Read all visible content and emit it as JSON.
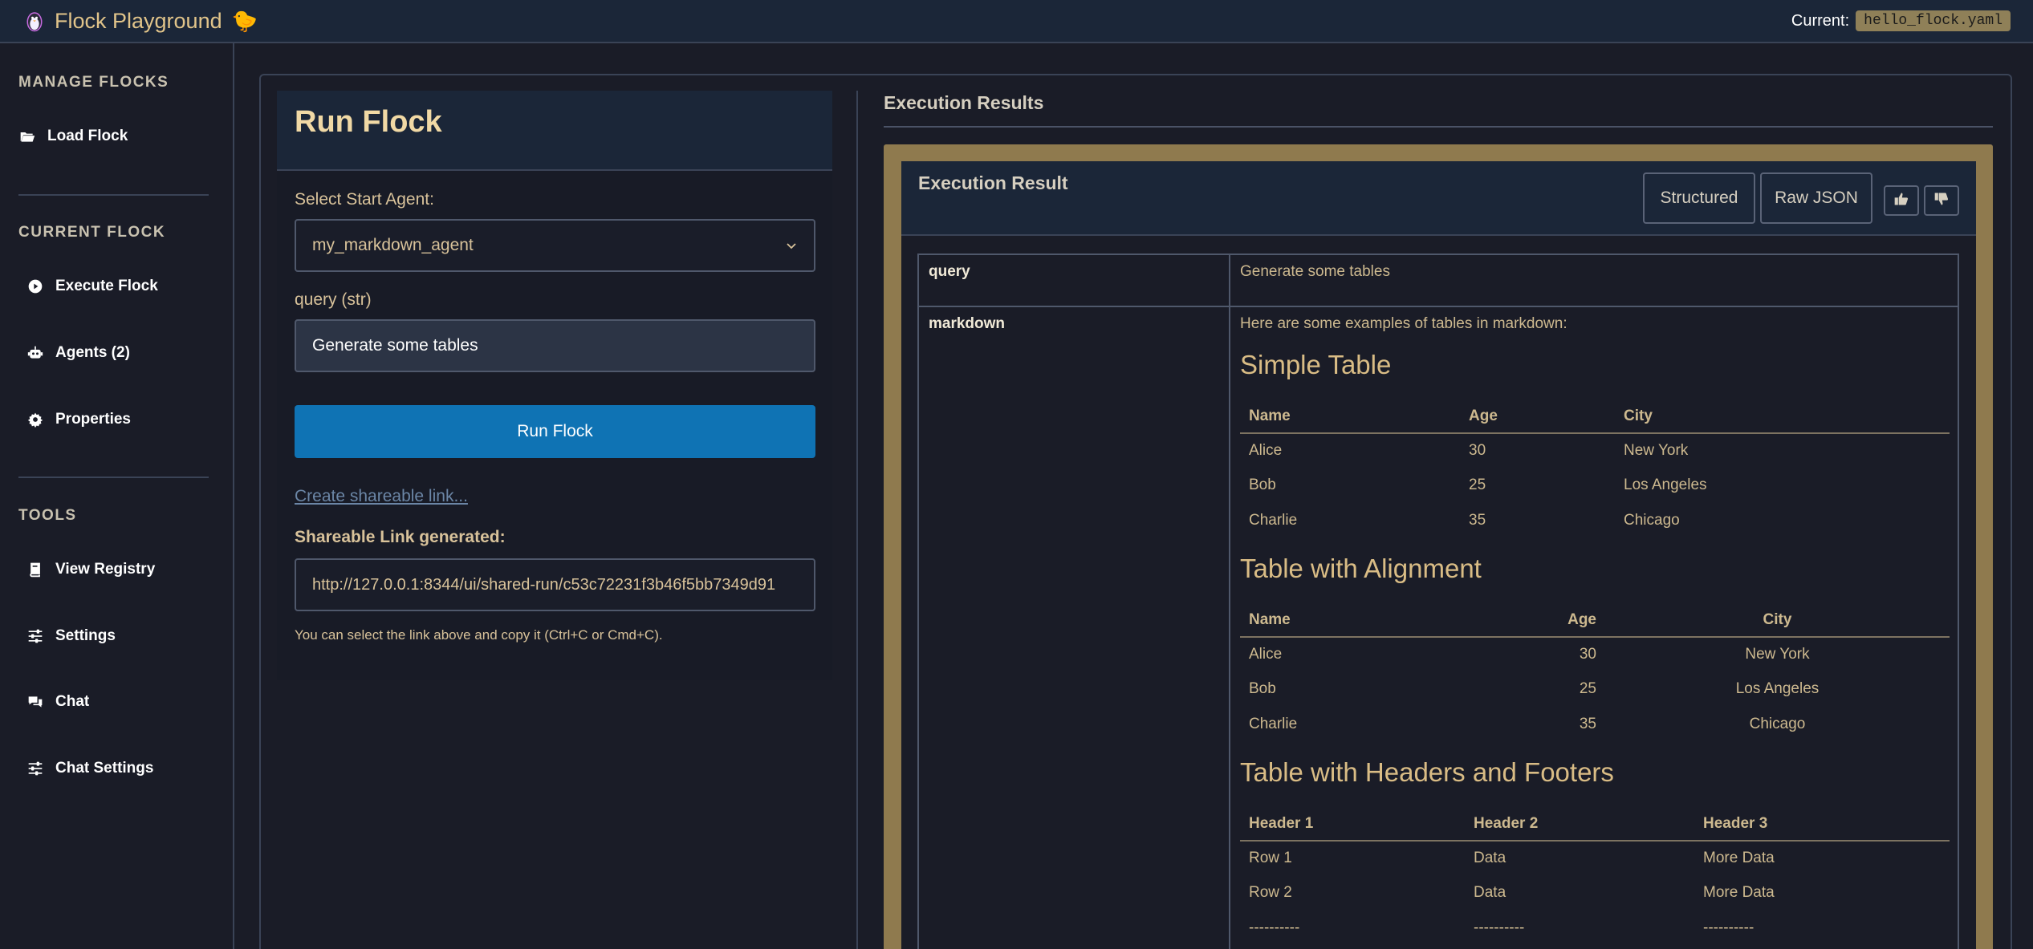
{
  "header": {
    "title": "Flock Playground",
    "title_emoji": "🐤",
    "current_label": "Current:",
    "current_file": "hello_flock.yaml"
  },
  "sidebar": {
    "manage_title": "MANAGE FLOCKS",
    "load_flock": "Load Flock",
    "current_title": "CURRENT FLOCK",
    "execute_flock": "Execute Flock",
    "agents": "Agents (2)",
    "properties": "Properties",
    "tools_title": "TOOLS",
    "view_registry": "View Registry",
    "settings": "Settings",
    "chat": "Chat",
    "chat_settings": "Chat Settings"
  },
  "run_panel": {
    "title": "Run Flock",
    "select_label": "Select Start Agent:",
    "selected_agent": "my_markdown_agent",
    "query_label": "query (str)",
    "query_value": "Generate some tables",
    "run_button": "Run Flock",
    "share_link_text": "Create shareable link...",
    "share_title": "Shareable Link generated:",
    "share_url": "http://127.0.0.1:8344/ui/shared-run/c53c72231f3b46f5bb7349d91",
    "share_hint": "You can select the link above and copy it (Ctrl+C or Cmd+C)."
  },
  "results": {
    "section_title": "Execution Results",
    "card_title": "Execution Result",
    "structured_btn": "Structured",
    "raw_json_btn": "Raw JSON",
    "query_key": "query",
    "query_val": "Generate some tables",
    "markdown_key": "markdown",
    "markdown_intro": "Here are some examples of tables in markdown:",
    "simple_title": "Simple Table",
    "simple_headers": [
      "Name",
      "Age",
      "City"
    ],
    "simple_rows": [
      [
        "Alice",
        "30",
        "New York"
      ],
      [
        "Bob",
        "25",
        "Los Angeles"
      ],
      [
        "Charlie",
        "35",
        "Chicago"
      ]
    ],
    "align_title": "Table with Alignment",
    "align_headers": [
      "Name",
      "Age",
      "City"
    ],
    "align_rows": [
      [
        "Alice",
        "30",
        "New York"
      ],
      [
        "Bob",
        "25",
        "Los Angeles"
      ],
      [
        "Charlie",
        "35",
        "Chicago"
      ]
    ],
    "hf_title": "Table with Headers and Footers",
    "hf_headers": [
      "Header 1",
      "Header 2",
      "Header 3"
    ],
    "hf_rows": [
      [
        "Row 1",
        "Data",
        "More Data"
      ],
      [
        "Row 2",
        "Data",
        "More Data"
      ],
      [
        "----------",
        "----------",
        "----------"
      ]
    ]
  },
  "colors": {
    "accent_gold": "#e1c48a",
    "run_button_blue": "#0f73b4",
    "card_frame": "#8f7a4e"
  }
}
